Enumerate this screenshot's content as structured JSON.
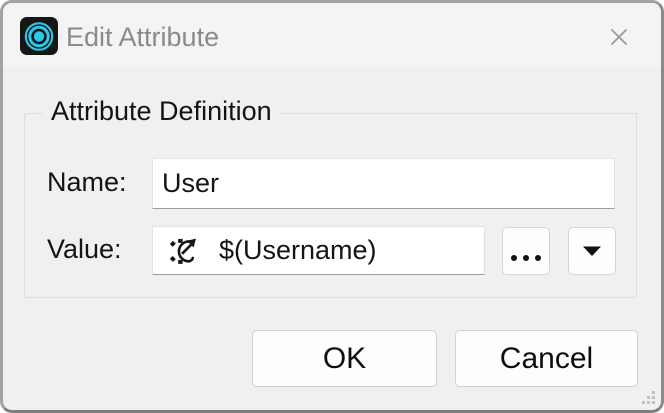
{
  "window": {
    "title": "Edit Attribute"
  },
  "group": {
    "label": "Attribute Definition"
  },
  "fields": {
    "name": {
      "label": "Name:",
      "value": "User"
    },
    "value": {
      "label": "Value:",
      "value": "$(Username)"
    }
  },
  "buttons": {
    "ok": "OK",
    "cancel": "Cancel"
  },
  "icons": {
    "app": "concentric-circles",
    "close": "✕",
    "expression": "gear-arrow",
    "browse": "ellipsis-dots",
    "dropdown": "▼",
    "resize": "grip-dots"
  },
  "colors": {
    "accent_cyan": "#2bc8e8",
    "icon_bg": "#161616",
    "dialog_bg": "#f0f0f0",
    "title_fg": "#8a8a8a",
    "text_fg": "#141414",
    "input_bg": "#ffffff",
    "input_bottom_border": "#9c9c9c",
    "button_bg": "#fdfdfd"
  }
}
